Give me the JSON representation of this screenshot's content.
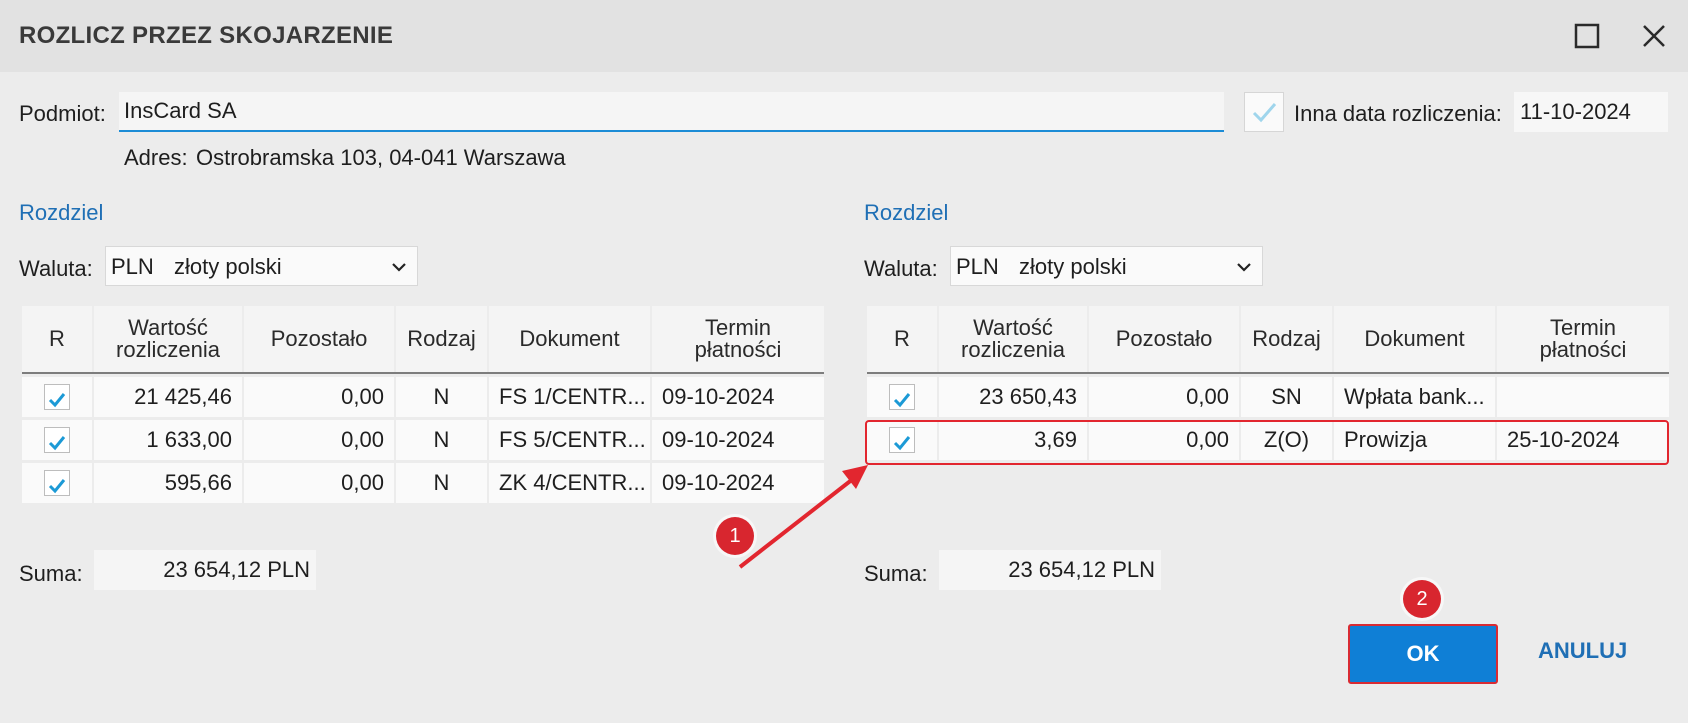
{
  "window": {
    "title": "ROZLICZ PRZEZ SKOJARZENIE",
    "maximize_icon": "maximize-icon",
    "close_icon": "close-icon"
  },
  "form": {
    "podmiot_label": "Podmiot:",
    "podmiot_value": "InsCard SA",
    "adres_label": "Adres:",
    "adres_value": "Ostrobramska 103, 04-041 Warszawa",
    "inna_data_checked": true,
    "inna_data_label": "Inna data rozliczenia:",
    "inna_data_value": "11-10-2024"
  },
  "left_panel": {
    "rozdziel": "Rozdziel",
    "waluta_label": "Waluta:",
    "currency_code": "PLN",
    "currency_name": "złoty polski",
    "columns": [
      "R",
      "Wartość rozliczenia",
      "Pozostało",
      "Rodzaj",
      "Dokument",
      "Termin płatności"
    ],
    "rows": [
      {
        "checked": true,
        "wartosc": "21 425,46",
        "pozostalo": "0,00",
        "rodzaj": "N",
        "dokument": "FS 1/CENTR...",
        "termin": "09-10-2024"
      },
      {
        "checked": true,
        "wartosc": "1 633,00",
        "pozostalo": "0,00",
        "rodzaj": "N",
        "dokument": "FS 5/CENTR...",
        "termin": "09-10-2024"
      },
      {
        "checked": true,
        "wartosc": "595,66",
        "pozostalo": "0,00",
        "rodzaj": "N",
        "dokument": "ZK 4/CENTR...",
        "termin": "09-10-2024"
      }
    ],
    "suma_label": "Suma:",
    "suma_value": "23 654,12 PLN"
  },
  "right_panel": {
    "rozdziel": "Rozdziel",
    "waluta_label": "Waluta:",
    "currency_code": "PLN",
    "currency_name": "złoty polski",
    "columns": [
      "R",
      "Wartość rozliczenia",
      "Pozostało",
      "Rodzaj",
      "Dokument",
      "Termin płatności"
    ],
    "rows": [
      {
        "checked": true,
        "wartosc": "23 650,43",
        "pozostalo": "0,00",
        "rodzaj": "SN",
        "dokument": "Wpłata bank...",
        "termin": ""
      },
      {
        "checked": true,
        "wartosc": "3,69",
        "pozostalo": "0,00",
        "rodzaj": "Z(O)",
        "dokument": "Prowizja",
        "termin": "25-10-2024"
      }
    ],
    "suma_label": "Suma:",
    "suma_value": "23 654,12 PLN"
  },
  "buttons": {
    "ok": "OK",
    "cancel": "ANULUJ"
  },
  "annotations": {
    "badge_1": "1",
    "badge_2": "2"
  },
  "colors": {
    "accent": "#0f7fd6",
    "link": "#1f6fb5",
    "annotation": "#d8262f",
    "check": "#1c9ad6"
  }
}
